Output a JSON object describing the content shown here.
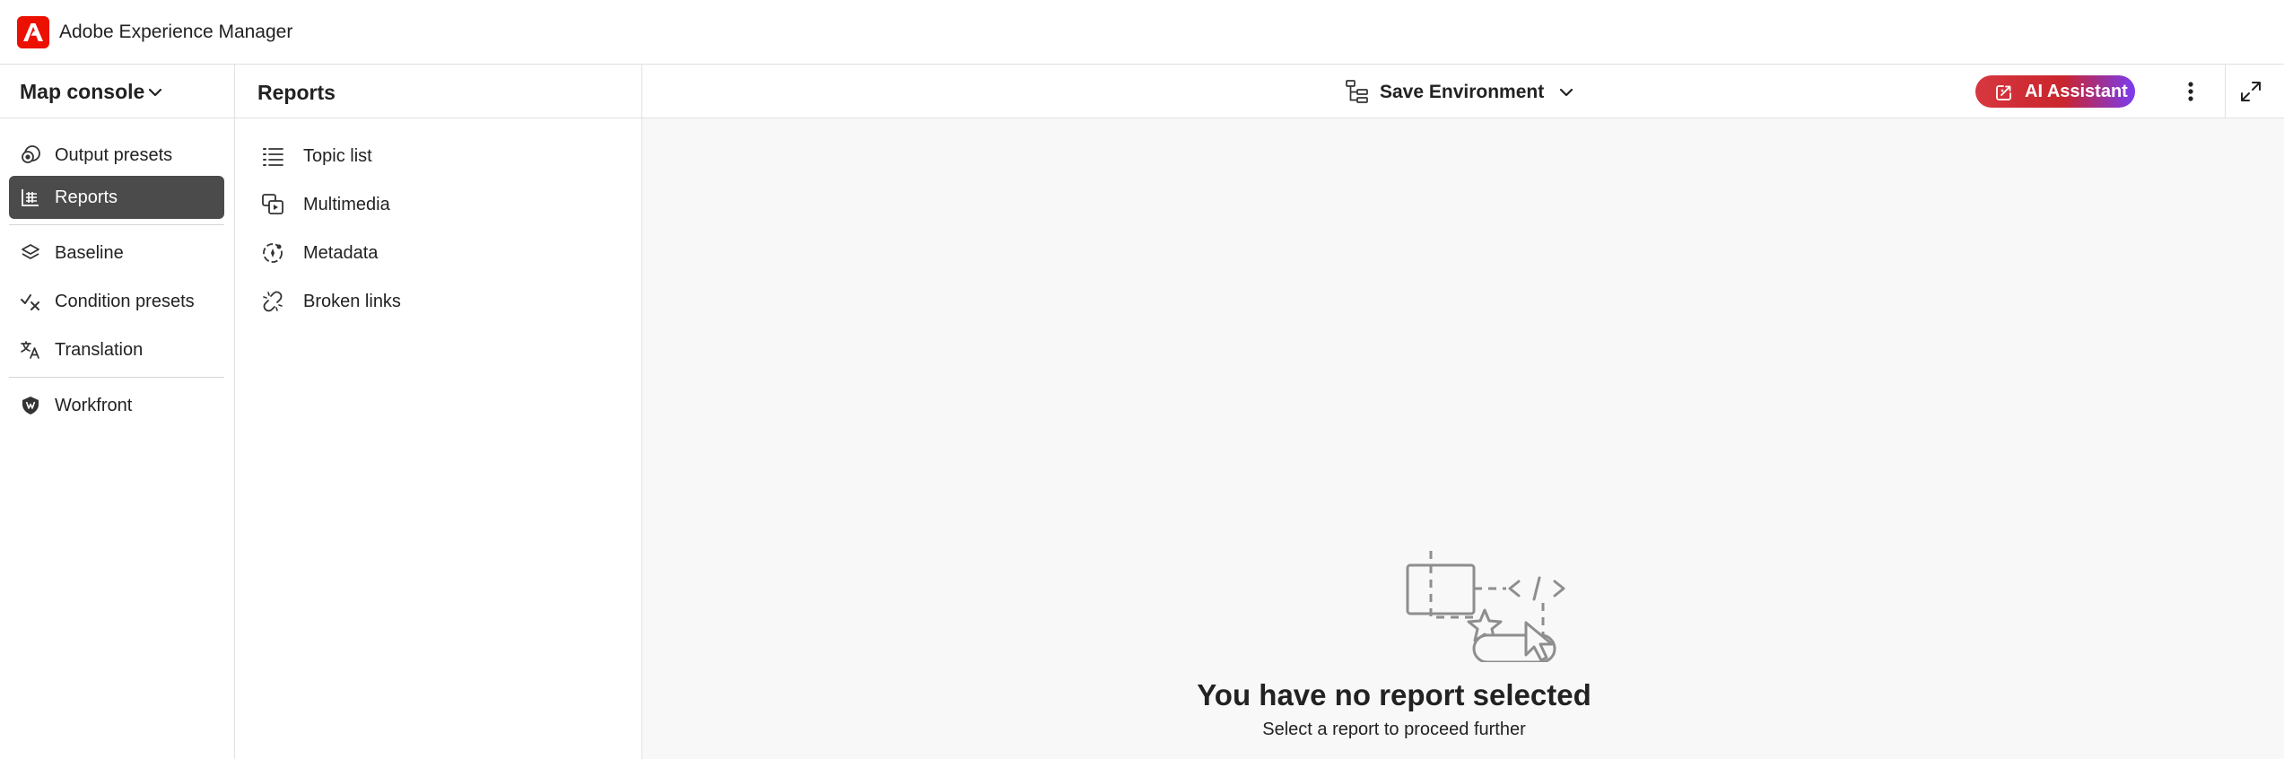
{
  "app": {
    "title": "Adobe Experience Manager",
    "brand_color": "#eb1000"
  },
  "leftnav": {
    "title": "Map console",
    "selected_bg": "#4b4b4b",
    "items": [
      {
        "label": "Output presets",
        "icon": "output-presets-icon"
      },
      {
        "label": "Reports",
        "icon": "reports-icon",
        "selected": true
      },
      {
        "label": "Baseline",
        "icon": "baseline-layers-icon"
      },
      {
        "label": "Condition presets",
        "icon": "condition-presets-icon"
      },
      {
        "label": "Translation",
        "icon": "translation-icon"
      },
      {
        "label": "Workfront",
        "icon": "workfront-icon"
      }
    ]
  },
  "reports": {
    "title": "Reports",
    "items": [
      {
        "label": "Topic list",
        "icon": "list-icon"
      },
      {
        "label": "Multimedia",
        "icon": "multimedia-icon"
      },
      {
        "label": "Metadata",
        "icon": "metadata-icon"
      },
      {
        "label": "Broken links",
        "icon": "broken-link-icon"
      }
    ]
  },
  "toolbar": {
    "environment_label": "Save Environment",
    "ai_label": "AI Assistant",
    "ai_gradient": [
      "#d7373f",
      "#7a3cf0"
    ]
  },
  "empty_state": {
    "title": "You have no report selected",
    "subtitle": "Select a report to proceed further"
  }
}
